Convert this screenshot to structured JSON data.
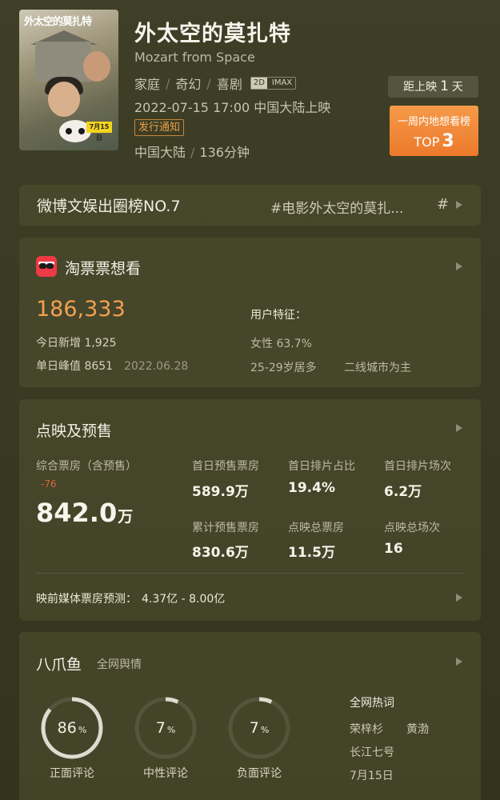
{
  "header": {
    "title_cn": "外太空的莫扎特",
    "title_en": "Mozart from Space",
    "genres": [
      "家庭",
      "奇幻",
      "喜剧"
    ],
    "formats": [
      "2D",
      "IMAX"
    ],
    "release": "2022-07-15 17:00 中国大陆上映",
    "notice_label": "发行通知",
    "region": "中国大陆",
    "duration": "136分钟",
    "poster": {
      "title": "外太空的莫扎特",
      "date": "7月15日"
    }
  },
  "countdown": {
    "prefix": "距上映",
    "days": "1",
    "suffix": "天"
  },
  "want_rank": {
    "label": "一周内地想看榜",
    "top_prefix": "TOP",
    "rank": "3"
  },
  "weibo": {
    "rank_label": "微博文娱出圈榜NO.7",
    "topic": "#电影外太空的莫扎...",
    "hash": "#"
  },
  "taopiao": {
    "title": "淘票票想看",
    "total": "186,333",
    "today_label": "今日新增",
    "today_value": "1,925",
    "peak_label": "单日峰值",
    "peak_value": "8651",
    "peak_date": "2022.06.28",
    "feature_label": "用户特征：",
    "female": "女性 63.7%",
    "age": "25-29岁居多",
    "city": "二线城市为主"
  },
  "presale": {
    "title": "点映及预售",
    "total_label": "综合票房（含预售）",
    "total_delta": "-76",
    "total_value": "842.0",
    "total_unit": "万",
    "stats": [
      {
        "label": "首日预售票房",
        "value": "589.9万"
      },
      {
        "label": "首日排片占比",
        "value": "19.4%"
      },
      {
        "label": "首日排片场次",
        "value": "6.2万"
      },
      {
        "label": "累计预售票房",
        "value": "830.6万"
      },
      {
        "label": "点映总票房",
        "value": "11.5万"
      },
      {
        "label": "点映总场次",
        "value": "16"
      }
    ],
    "forecast_label": "映前媒体票房预测：",
    "forecast_range": "4.37亿 - 8.00亿"
  },
  "bazhuayu": {
    "title": "八爪鱼",
    "subtitle": "全网舆情",
    "pct_sign": "%",
    "sentiments": [
      {
        "label": "正面评论",
        "value": 86
      },
      {
        "label": "中性评论",
        "value": 7
      },
      {
        "label": "负面评论",
        "value": 7
      }
    ],
    "hot_title": "全网热词",
    "hot_words": [
      "荣梓杉",
      "黄渤",
      "长江七号",
      "7月15日"
    ]
  },
  "colors": {
    "accent_orange": "#f2a151",
    "rank_box": "#ec7a2c",
    "notice": "#e8a04a",
    "delta_red": "#d8693e",
    "ring_fg": "#dedbd0",
    "ring_bg": "#55553c"
  }
}
